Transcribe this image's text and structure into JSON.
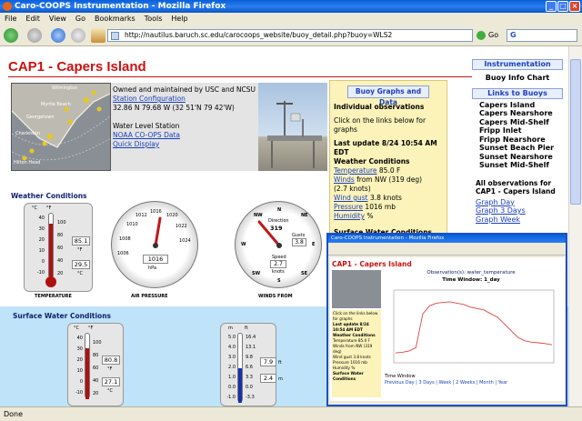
{
  "window": {
    "title": "Caro-COOPS Instrumentation - Mozilla Firefox"
  },
  "menu": [
    "File",
    "Edit",
    "View",
    "Go",
    "Bookmarks",
    "Tools",
    "Help"
  ],
  "toolbar": {
    "url": "http://nautilus.baruch.sc.edu/carocoops_website/buoy_detail.php?buoy=WLS2",
    "go_label": "Go",
    "search_value": "G"
  },
  "page": {
    "title": "CAP1 - Capers Island",
    "map_labels": [
      "Myrtle Beach",
      "Georgetown",
      "Charleston",
      "Hilton Head",
      "Wilmington"
    ],
    "station": {
      "line1": "Owned and maintained by USC and NCSU",
      "config_link": "Station Configuration",
      "coords": "32.86 N 79.68 W (32 51'N 79 42'W)",
      "water_level": "Water Level Station",
      "noaa_link": "NOAA CO-OPS Data",
      "quick_link": "Quick Display"
    },
    "buoy_panel": {
      "button": "Buoy Graphs and Data",
      "heading": "Individual observations",
      "instruction": "Click on the links below for graphs",
      "last_update": "Last update 8/24 10:54 AM EDT",
      "weather_heading": "Weather Conditions",
      "rows": [
        {
          "label": "Temperature",
          "value": "85.0 F"
        },
        {
          "label": "Winds",
          "value": "from NW (319 deg)"
        },
        {
          "label": "",
          "value": "(2.7 knots)"
        },
        {
          "label": "Wind gust",
          "value": "3.8 knots"
        },
        {
          "label": "Pressure",
          "value": "1016 mb"
        },
        {
          "label": "Humidity",
          "value": "%"
        }
      ],
      "surface_heading": "Surface Water Conditions"
    },
    "right_panel": {
      "instrumentation": "Instrumentation",
      "buoy_info": "Buoy Info Chart",
      "links_heading": "Links to Buoys",
      "buoys": [
        "Capers Island",
        "Capers Nearshore",
        "Capers Mid-Shelf",
        "Fripp Inlet",
        "Fripp Nearshore",
        "Sunset Beach Pier",
        "Sunset Nearshore",
        "Sunset Mid-Shelf"
      ],
      "all_obs": "All observations for CAP1 - Capers Island",
      "graph_links": [
        "Graph Day",
        "Graph 3 Days",
        "Graph Week"
      ]
    },
    "weather_section": {
      "title": "Weather Conditions",
      "thermo": {
        "unit_c": "°C",
        "unit_f": "°F",
        "c_ticks": [
          "40",
          "30",
          "20",
          "10",
          "0",
          "-10"
        ],
        "f_ticks": [
          "100",
          "80",
          "60",
          "40",
          "20"
        ],
        "value_f": "85.1",
        "f_label": "°F",
        "value_c": "29.5",
        "c_label": "°C",
        "caption": "TEMPERATURE",
        "level": 0.85
      },
      "pressure": {
        "ticks": [
          "1010",
          "1012",
          "1014",
          "1016",
          "1018",
          "1020",
          "1022",
          "1024",
          "1006",
          "1008"
        ],
        "value": "1016",
        "unit": "hPa",
        "caption": "AIR PRESSURE"
      },
      "wind": {
        "dirs": [
          "NW",
          "N",
          "NE",
          "W",
          "E",
          "SW",
          "S",
          "SE"
        ],
        "direction_label": "Direction",
        "direction": "319",
        "gusts_label": "Gusts",
        "gusts": "3.8",
        "speed_label": "Speed",
        "speed": "2.7",
        "speed_unit": "knots",
        "caption": "WINDS FROM"
      }
    },
    "surface_section": {
      "title": "Surface Water Conditions",
      "thermo": {
        "unit_c": "°C",
        "unit_f": "°F",
        "c_ticks": [
          "40",
          "30",
          "20",
          "10",
          "0",
          "-10"
        ],
        "f_ticks": [
          "100",
          "80",
          "60",
          "40",
          "20"
        ],
        "value_f": "80.8",
        "f_label": "°F",
        "value_c": "27.1",
        "c_label": "°C",
        "level": 0.78
      },
      "level": {
        "unit_m": "m",
        "unit_ft": "ft",
        "m_ticks": [
          "5.0",
          "4.0",
          "3.0",
          "2.0",
          "1.0",
          "0.0",
          "-1.0"
        ],
        "ft_ticks": [
          "16.4",
          "13.1",
          "9.8",
          "6.6",
          "3.3",
          "0.0",
          "-3.3"
        ],
        "value_ft": "7.9",
        "ft_label": "ft",
        "value_m": "2.4",
        "m_label": "m",
        "level": 0.5
      }
    }
  },
  "popup": {
    "title": "Caro-COOPS Instrumentation - Mozilla Firefox",
    "page_title": "CAP1 - Capers Island",
    "obs_title": "Observation(s): water_temperature",
    "window_label": "Time Window: 1_day",
    "side_lines": [
      "Click on the links below for graphs",
      "Last update 8/24 10:54 AM EDT",
      "Weather Conditions",
      "Temperature 85.0 F",
      "Winds from NW (319 deg)",
      "Wind gust 3.8 knots",
      "Pressure 1016 mb",
      "Humidity %",
      "Surface Water Conditions"
    ],
    "time_window_label": "Time Window",
    "time_window_links": "Previous Day | 3 Days | Week | 2 Weeks | Month | Year",
    "chart_data": {
      "type": "line",
      "y": [
        0.12,
        0.13,
        0.15,
        0.2,
        0.7,
        0.82,
        0.86,
        0.87,
        0.88,
        0.86,
        0.84,
        0.8,
        0.78,
        0.76,
        0.7,
        0.65,
        0.55,
        0.45,
        0.35,
        0.3,
        0.28,
        0.27,
        0.26,
        0.24
      ]
    }
  },
  "status": "Done"
}
